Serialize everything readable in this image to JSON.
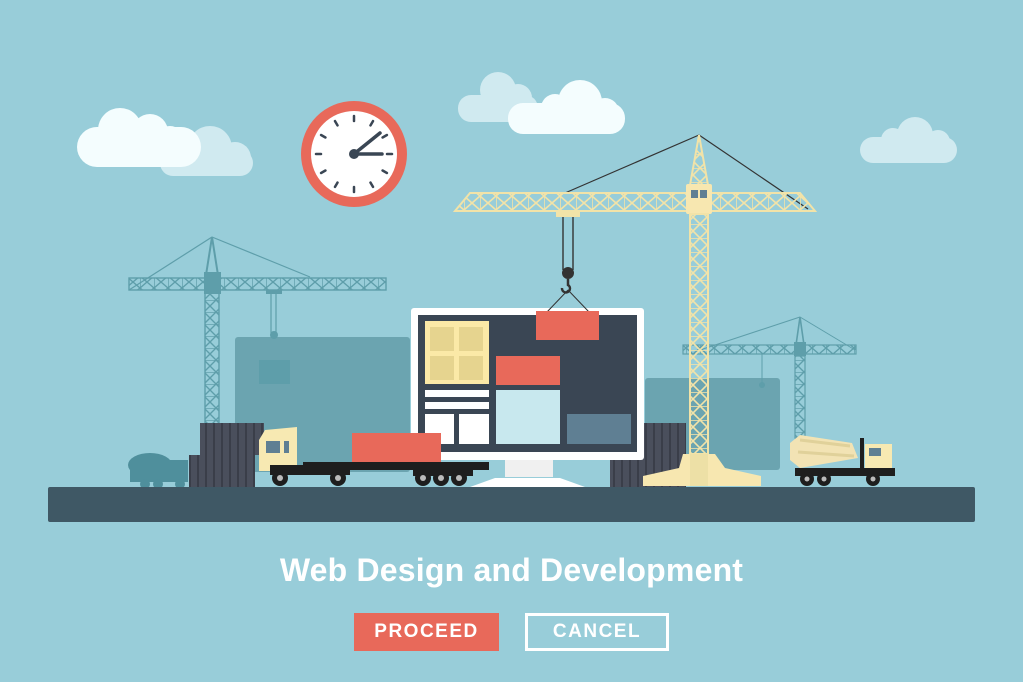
{
  "banner": {
    "title": "Web Design and Development",
    "illustration": "construction-site building a website on a monitor",
    "clock": {
      "hour": 2,
      "minute": 15
    }
  },
  "actions": {
    "proceed_label": "PROCEED",
    "cancel_label": "CANCEL"
  },
  "colors": {
    "background": "#98cdd9",
    "accent": "#e8695a",
    "ground": "#3f5865",
    "crane": "#f2e3a8",
    "crane_bg": "#5e9eaa",
    "screen": "#3a4654",
    "text": "#ffffff"
  },
  "icons": [
    "clock-icon",
    "cloud-icon",
    "crane-icon",
    "monitor-icon",
    "truck-icon",
    "cement-mixer-icon",
    "container-icon"
  ]
}
